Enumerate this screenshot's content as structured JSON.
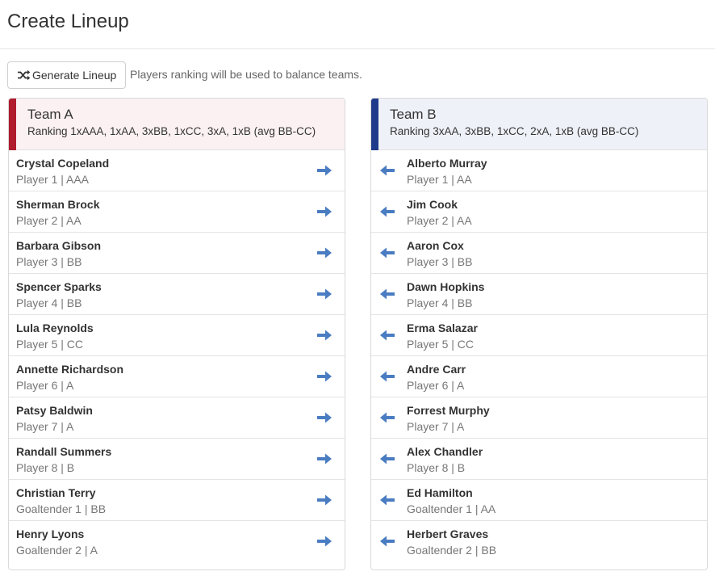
{
  "page": {
    "title": "Create Lineup"
  },
  "toolbar": {
    "generate_label": "Generate Lineup",
    "hint": "Players ranking will be used to balance teams."
  },
  "colors": {
    "team_a_accent": "#b01b2e",
    "team_b_accent": "#1e3a8a",
    "arrow": "#4a7cc1"
  },
  "teams": [
    {
      "name": "Team A",
      "ranking": "Ranking 1xAAA, 1xAA, 3xBB, 1xCC, 3xA, 1xB (avg BB-CC)",
      "move_icon": "arrow-right-icon",
      "players": [
        {
          "name": "Crystal Copeland",
          "detail": "Player 1 | AAA"
        },
        {
          "name": "Sherman Brock",
          "detail": "Player 2 | AA"
        },
        {
          "name": "Barbara Gibson",
          "detail": "Player 3 | BB"
        },
        {
          "name": "Spencer Sparks",
          "detail": "Player 4 | BB"
        },
        {
          "name": "Lula Reynolds",
          "detail": "Player 5 | CC"
        },
        {
          "name": "Annette Richardson",
          "detail": "Player 6 | A"
        },
        {
          "name": "Patsy Baldwin",
          "detail": "Player 7 | A"
        },
        {
          "name": "Randall Summers",
          "detail": "Player 8 | B"
        },
        {
          "name": "Christian Terry",
          "detail": "Goaltender 1 | BB"
        },
        {
          "name": "Henry Lyons",
          "detail": "Goaltender 2 | A"
        }
      ]
    },
    {
      "name": "Team B",
      "ranking": "Ranking 3xAA, 3xBB, 1xCC, 2xA, 1xB (avg BB-CC)",
      "move_icon": "arrow-left-icon",
      "players": [
        {
          "name": "Alberto Murray",
          "detail": "Player 1 | AA"
        },
        {
          "name": "Jim Cook",
          "detail": "Player 2 | AA"
        },
        {
          "name": "Aaron Cox",
          "detail": "Player 3 | BB"
        },
        {
          "name": "Dawn Hopkins",
          "detail": "Player 4 | BB"
        },
        {
          "name": "Erma Salazar",
          "detail": "Player 5 | CC"
        },
        {
          "name": "Andre Carr",
          "detail": "Player 6 | A"
        },
        {
          "name": "Forrest Murphy",
          "detail": "Player 7 | A"
        },
        {
          "name": "Alex Chandler",
          "detail": "Player 8 | B"
        },
        {
          "name": "Ed Hamilton",
          "detail": "Goaltender 1 | AA"
        },
        {
          "name": "Herbert Graves",
          "detail": "Goaltender 2 | BB"
        }
      ]
    }
  ]
}
